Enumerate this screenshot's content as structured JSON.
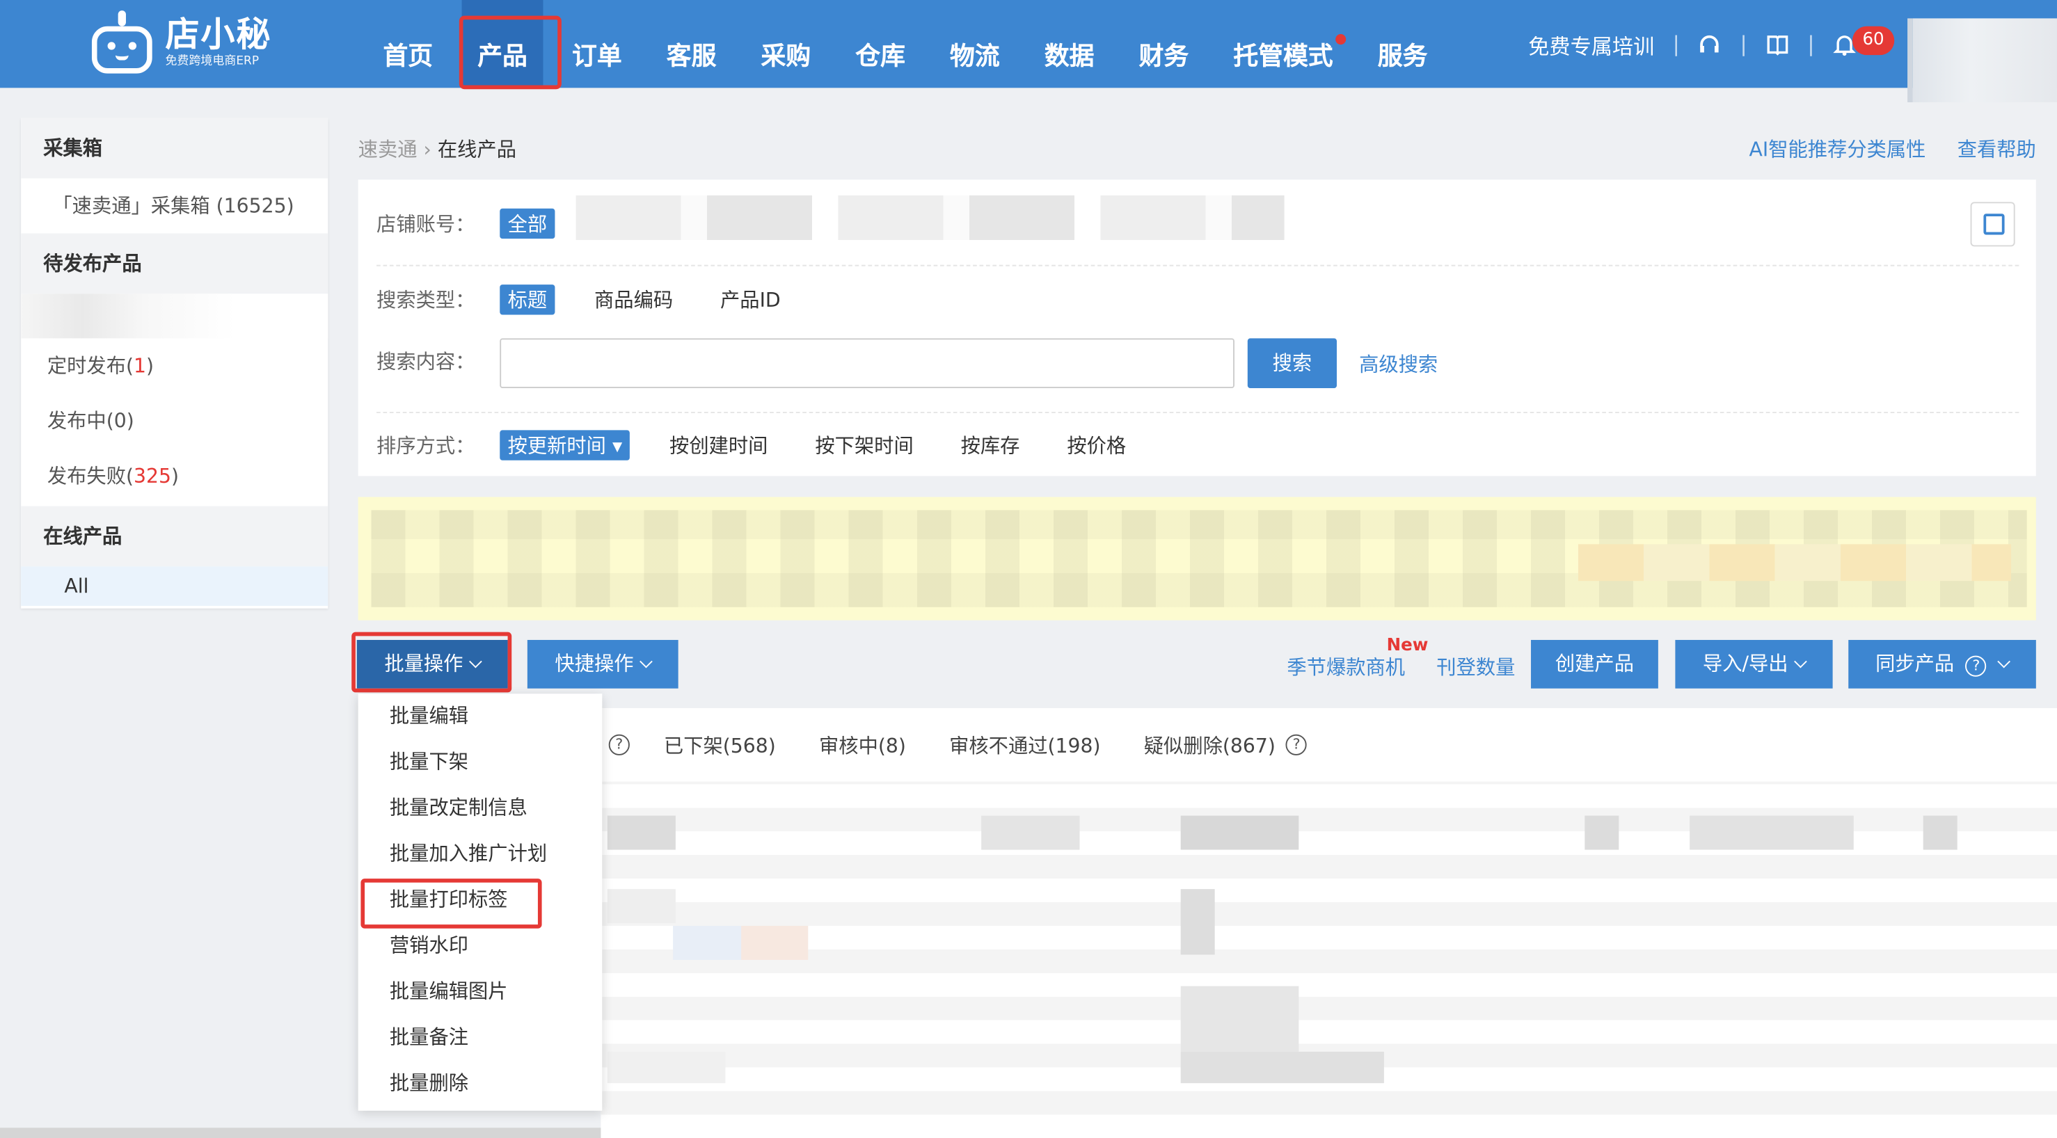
{
  "logo": {
    "brand": "店小秘",
    "sub": "免费跨境电商ERP"
  },
  "nav": {
    "items": [
      {
        "label": "首页"
      },
      {
        "label": "产品"
      },
      {
        "label": "订单"
      },
      {
        "label": "客服"
      },
      {
        "label": "采购"
      },
      {
        "label": "仓库"
      },
      {
        "label": "物流"
      },
      {
        "label": "数据"
      },
      {
        "label": "财务"
      },
      {
        "label": "托管模式"
      },
      {
        "label": "服务"
      }
    ],
    "active": "产品",
    "training": "免费专属培训",
    "notification_count": "60"
  },
  "sidebar": {
    "collect_title": "采集箱",
    "collect_item": "「速卖通」采集箱 (16525)",
    "pending_title": "待发布产品",
    "scheduled_label": "定时发布(",
    "scheduled_count": "1",
    "scheduled_close": ")",
    "publishing": "发布中(0)",
    "failed_label": "发布失败(",
    "failed_count": "325",
    "failed_close": ")",
    "online_title": "在线产品",
    "online_all": "All"
  },
  "breadcrumb": {
    "parent": "速卖通",
    "current": "在线产品"
  },
  "help": {
    "ai": "AI智能推荐分类属性",
    "help": "查看帮助"
  },
  "filters": {
    "store_label": "店铺账号：",
    "store_all": "全部",
    "search_type_label": "搜索类型：",
    "search_types": [
      "标题",
      "商品编码",
      "产品ID"
    ],
    "search_content_label": "搜索内容：",
    "search_input_value": "",
    "search_button": "搜索",
    "advanced": "高级搜索",
    "sort_label": "排序方式：",
    "sort_active": "按更新时间 ▾",
    "sort_options": [
      "按创建时间",
      "按下架时间",
      "按库存",
      "按价格"
    ]
  },
  "toolbar": {
    "bulk": "批量操作",
    "quick": "快捷操作",
    "season": "季节爆款商机",
    "new": "New",
    "pubcount": "刊登数量",
    "create": "创建产品",
    "import": "导入/导出",
    "sync": "同步产品"
  },
  "tabs": {
    "q": "?",
    "offline": "已下架(568)",
    "reviewing": "审核中(8)",
    "rejected": "审核不通过(198)",
    "suspected": "疑似删除(867)"
  },
  "bulk_menu": [
    "批量编辑",
    "批量下架",
    "批量改定制信息",
    "批量加入推广计划",
    "批量打印标签",
    "营销水印",
    "批量编辑图片",
    "批量备注",
    "批量删除"
  ],
  "colors": {
    "primary": "#3d86d1",
    "nav_active": "#2c6db8",
    "highlight": "#e53935",
    "notice_bg": "#fdfbd0"
  }
}
